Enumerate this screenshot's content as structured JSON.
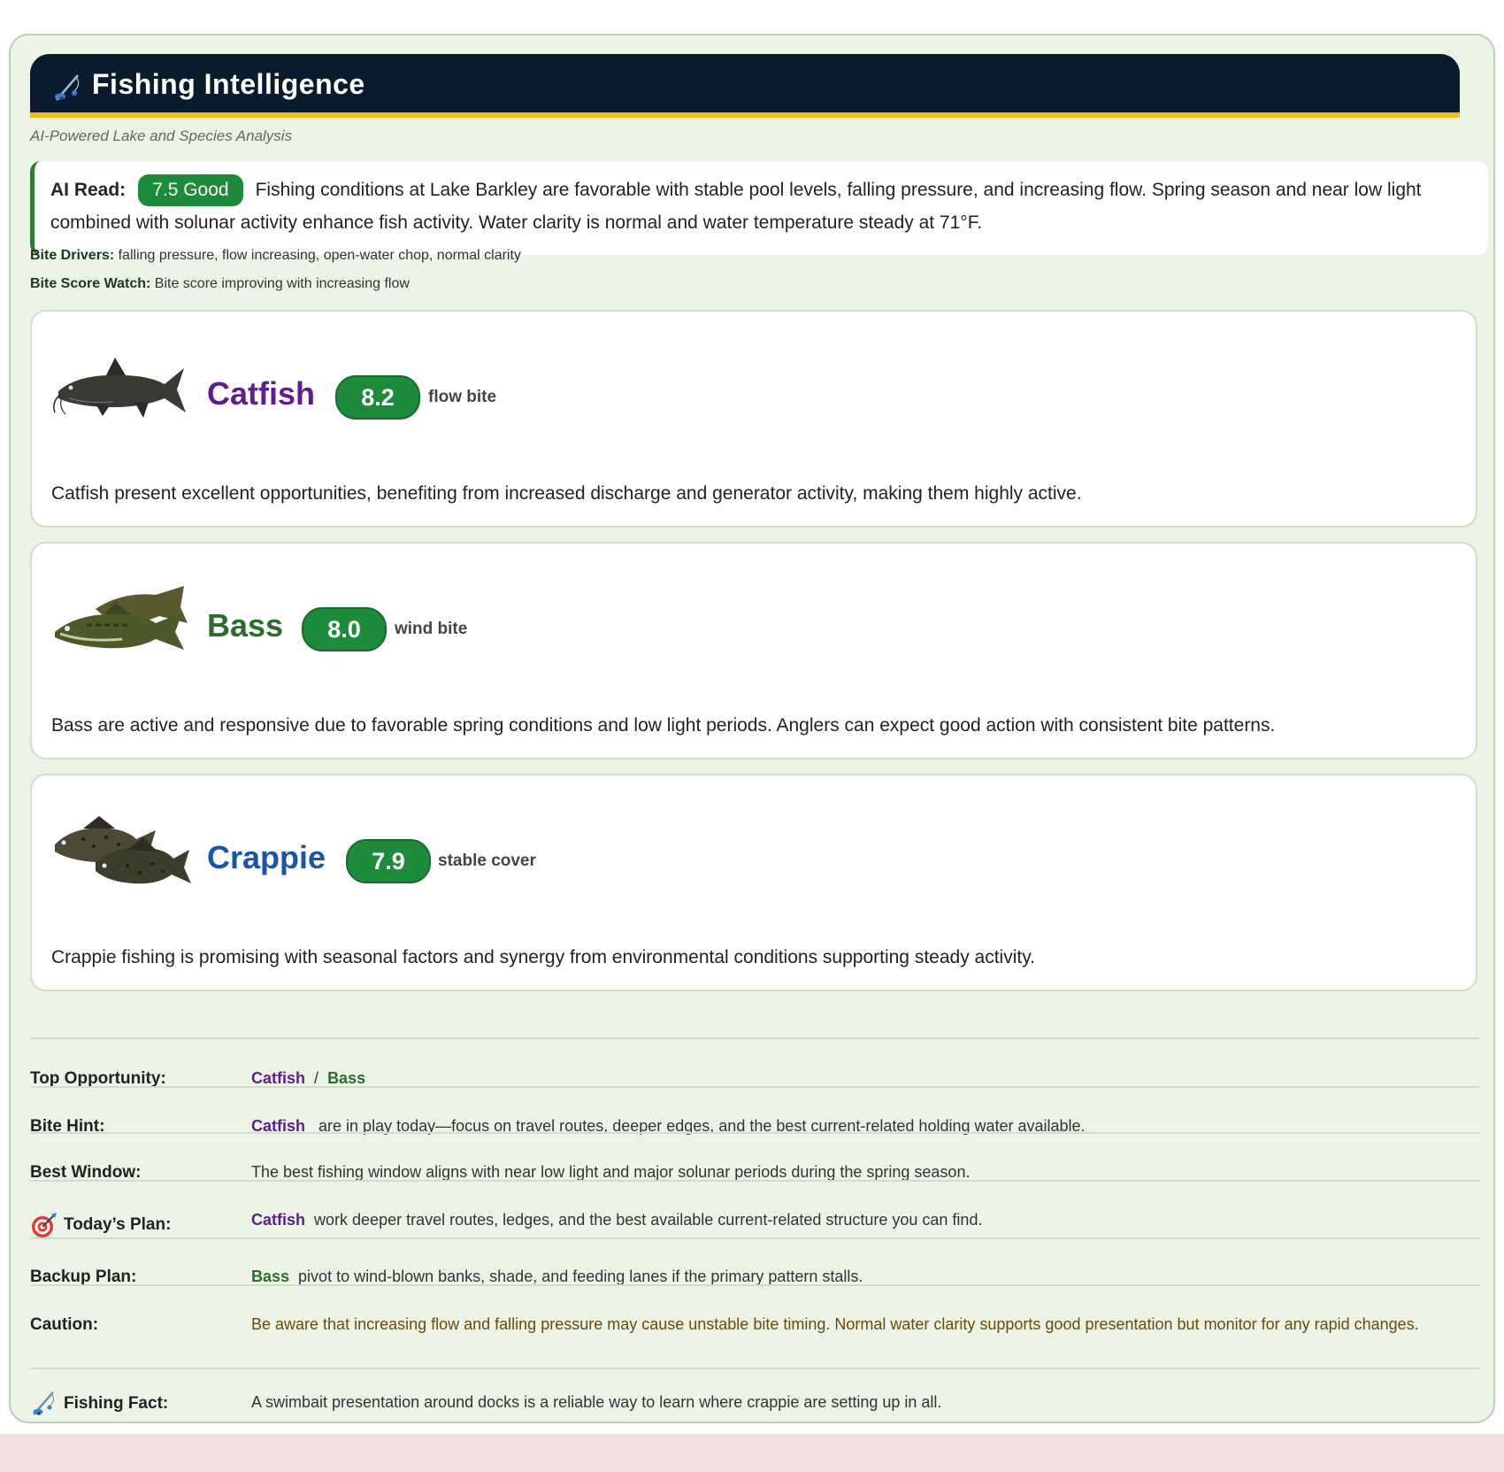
{
  "header": {
    "title": "Fishing Intelligence",
    "subtitle": "AI-Powered Lake and Species Analysis"
  },
  "ai_read": {
    "label": "AI Read:",
    "rating": "7.5 Good",
    "text": "Fishing conditions at Lake Barkley are favorable with stable pool levels, falling pressure, and increasing flow. Spring season and near low light combined with solunar activity enhance fish activity. Water clarity is normal and water temperature steady at 71°F."
  },
  "bite_drivers": {
    "label": "Bite Drivers:",
    "value": "falling pressure, flow increasing, open-water chop, normal clarity"
  },
  "bite_score_watch": {
    "label": "Bite Score Watch:",
    "value": "Bite score improving with increasing flow"
  },
  "species": [
    {
      "name": "Catfish",
      "score": "8.2",
      "tag": "flow bite",
      "color": "#5e1e8c",
      "description": "Catfish present excellent opportunities, benefiting from increased discharge and generator activity, making them highly active."
    },
    {
      "name": "Bass",
      "score": "8.0",
      "tag": "wind bite",
      "color": "#2e6b2e",
      "description": "Bass are active and responsive due to favorable spring conditions and low light periods. Anglers can expect good action with consistent bite patterns."
    },
    {
      "name": "Crappie",
      "score": "7.9",
      "tag": "stable cover",
      "color": "#1a56a8",
      "description": "Crappie fishing is promising with seasonal factors and synergy from environmental conditions supporting steady activity."
    }
  ],
  "summary": {
    "top_opportunity": {
      "label": "Top Opportunity:",
      "species_a": "Catfish",
      "separator": "/",
      "species_b": "Bass"
    },
    "bite_hint": {
      "label": "Bite Hint:",
      "species": "Catfish",
      "text": "are in play today—focus on travel routes, deeper edges, and the best current-related holding water available."
    },
    "best_window": {
      "label": "Best Window:",
      "text": "The best fishing window aligns with near low light and major solunar periods during the spring season."
    },
    "todays_plan": {
      "label": "Today’s Plan:",
      "species": "Catfish",
      "text": "work deeper travel routes, ledges, and the best available current-related structure you can find."
    },
    "backup_plan": {
      "label": "Backup Plan:",
      "species": "Bass",
      "text": "pivot to wind-blown banks, shade, and feeding lanes if the primary pattern stalls."
    },
    "caution": {
      "label": "Caution:",
      "text": "Be aware that increasing flow and falling pressure may cause unstable bite timing. Normal water clarity supports good presentation but monitor for any rapid changes."
    },
    "fishing_fact": {
      "label": "Fishing Fact:",
      "text": "A swimbait presentation around docks is a reliable way to learn where crappie are setting up in all."
    }
  },
  "colors": {
    "header_bg": "#0b1b2e",
    "header_accent": "#f2bb1a",
    "panel_bg": "#ecf4e6",
    "score_green": "#1e8a3c",
    "catfish": "#5e1e8c",
    "bass": "#2e6b2e",
    "crappie": "#1a56a8",
    "caution": "#6b4a0a"
  },
  "icons": [
    "fishing-rod-icon",
    "target-icon",
    "catfish-image",
    "bass-image",
    "crappie-image"
  ]
}
